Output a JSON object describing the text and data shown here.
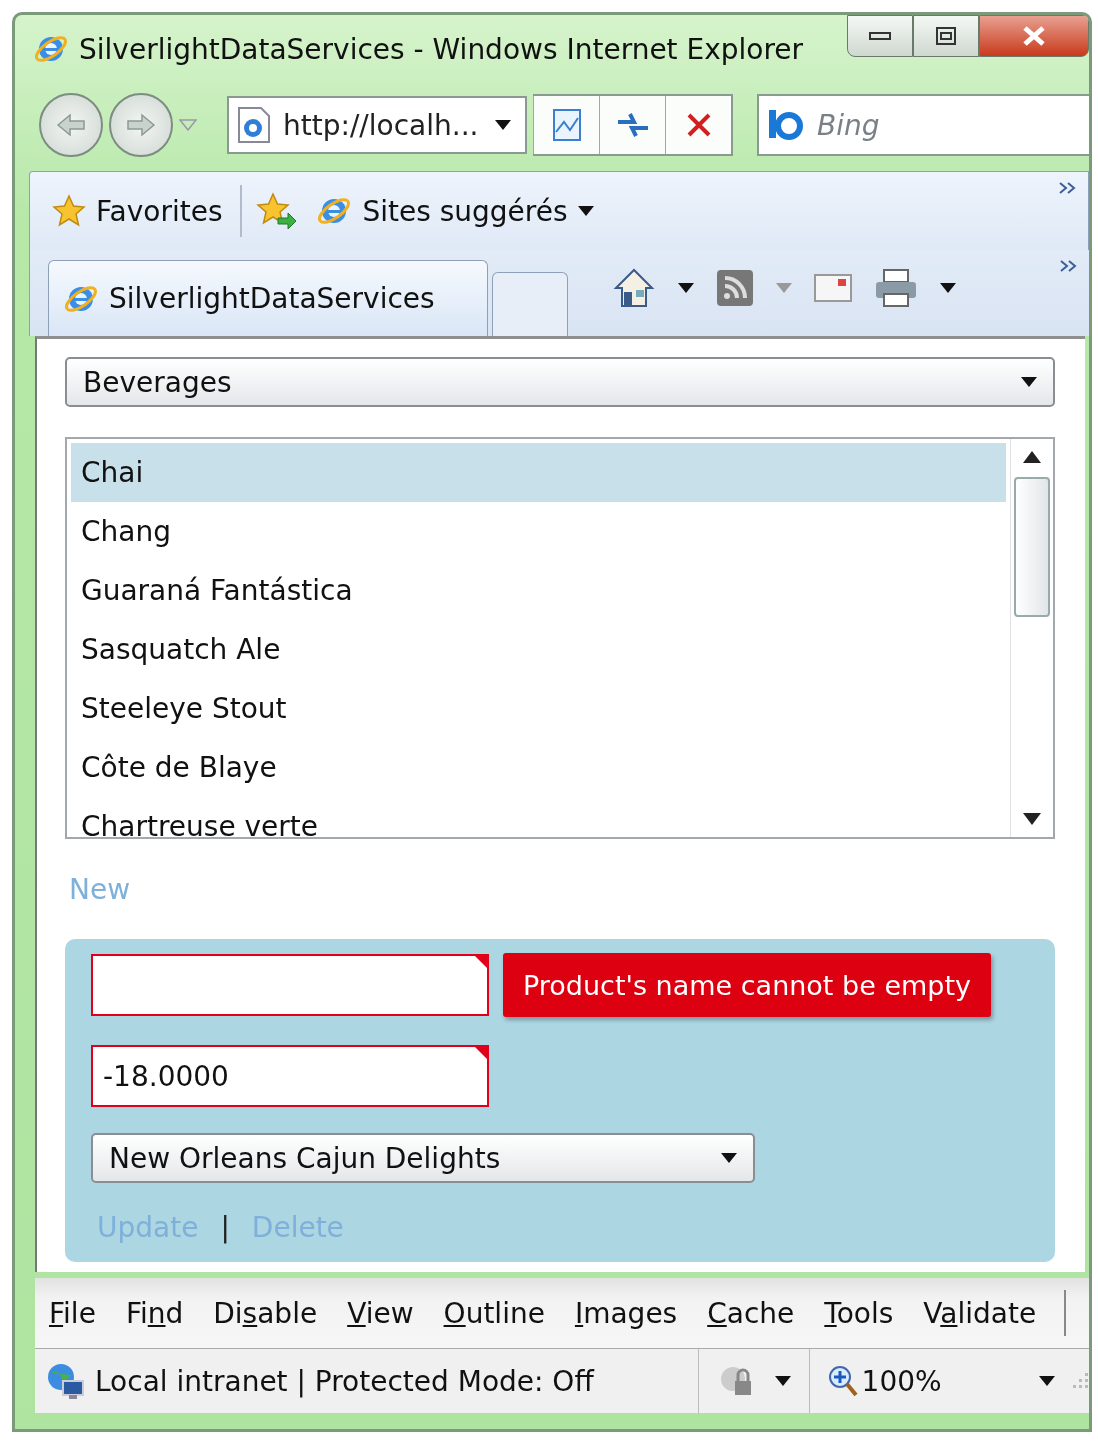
{
  "window": {
    "title": "SilverlightDataServices - Windows Internet Explorer"
  },
  "address_bar": {
    "value": "http://localh..."
  },
  "search": {
    "placeholder": "Bing"
  },
  "favorites_bar": {
    "favorites": "Favorites",
    "suggested": "Sites suggérés"
  },
  "tabs": [
    {
      "label": "SilverlightDataServices",
      "selected": true
    },
    {
      "selected": false
    }
  ],
  "page": {
    "category": {
      "value": "Beverages"
    },
    "products": [
      {
        "name": "Chai",
        "selected": true
      },
      {
        "name": "Chang",
        "selected": false
      },
      {
        "name": "Guaraná Fantástica",
        "selected": false
      },
      {
        "name": "Sasquatch Ale",
        "selected": false
      },
      {
        "name": "Steeleye Stout",
        "selected": false
      },
      {
        "name": "Côte de Blaye",
        "selected": false
      },
      {
        "name": "Chartreuse verte",
        "selected": false
      }
    ],
    "new_link": "New",
    "editor": {
      "name_field": {
        "invalid": true,
        "error": "Product's name cannot be empty"
      },
      "price_field": {
        "value": "-18.0000",
        "invalid": true
      },
      "supplier": {
        "value": "New Orleans Cajun Delights"
      },
      "actions": [
        "Update",
        "Delete"
      ],
      "separator": "|"
    }
  },
  "menu_bar": [
    {
      "key": "F",
      "after": "ile"
    },
    {
      "before": "Fi",
      "key": "n",
      "after": "d"
    },
    {
      "before": "Di",
      "key": "s",
      "after": "able"
    },
    {
      "key": "V",
      "after": "iew"
    },
    {
      "key": "O",
      "after": "utline"
    },
    {
      "key": "I",
      "after": "mages"
    },
    {
      "key": "C",
      "after": "ache"
    },
    {
      "key": "T",
      "after": "ools"
    },
    {
      "before": "V",
      "key": "a",
      "after": "lidate"
    }
  ],
  "status_bar": {
    "zone": "Local intranet | Protected Mode: Off",
    "zoom": "100%"
  }
}
